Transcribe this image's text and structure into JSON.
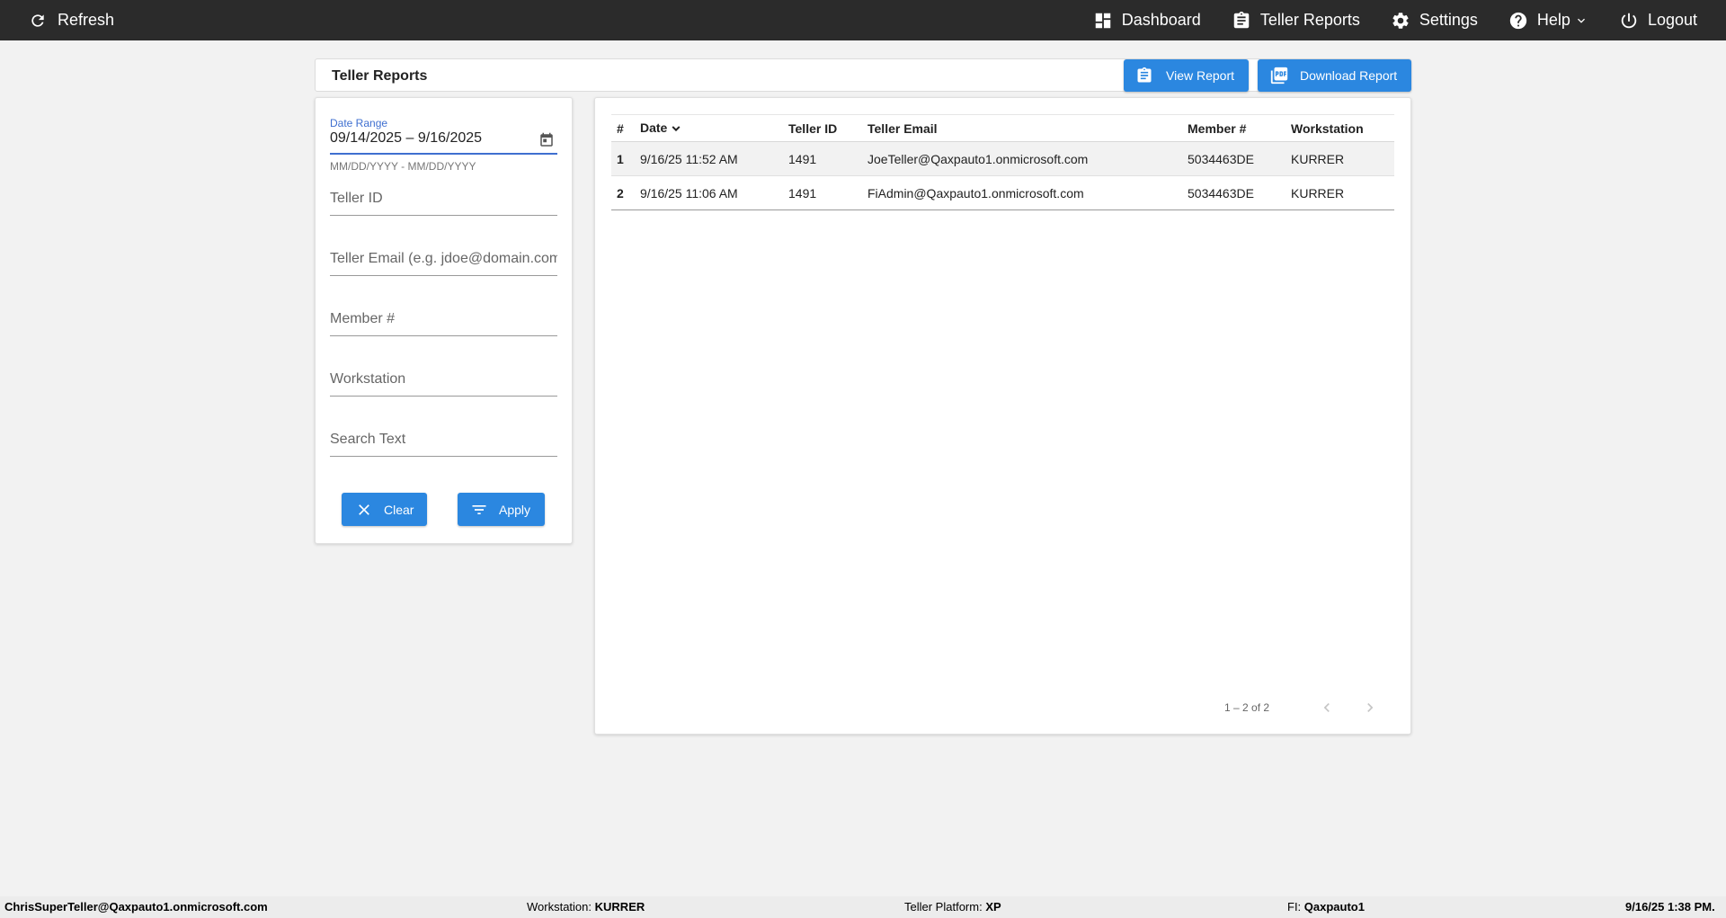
{
  "topbar": {
    "refresh_label": "Refresh",
    "nav": {
      "dashboard": "Dashboard",
      "teller_reports": "Teller Reports",
      "settings": "Settings",
      "help": "Help",
      "logout": "Logout"
    }
  },
  "page": {
    "title": "Teller Reports",
    "view_report_label": "View Report",
    "download_report_label": "Download Report"
  },
  "filters": {
    "date_range_label": "Date Range",
    "date_start": "09/14/2025",
    "date_separator": "–",
    "date_end": "9/16/2025",
    "date_hint": "MM/DD/YYYY - MM/DD/YYYY",
    "teller_id_placeholder": "Teller ID",
    "teller_email_placeholder": "Teller Email (e.g. jdoe@domain.com)",
    "member_placeholder": "Member #",
    "workstation_placeholder": "Workstation",
    "search_placeholder": "Search Text",
    "clear_label": "Clear",
    "apply_label": "Apply"
  },
  "table": {
    "headers": {
      "num": "#",
      "date": "Date",
      "teller_id": "Teller ID",
      "teller_email": "Teller Email",
      "member": "Member #",
      "workstation": "Workstation"
    },
    "rows": [
      {
        "num": "1",
        "date": "9/16/25 11:52 AM",
        "teller_id": "1491",
        "teller_email": "JoeTeller@Qaxpauto1.onmicrosoft.com",
        "member": "5034463DE",
        "workstation": "KURRER"
      },
      {
        "num": "2",
        "date": "9/16/25 11:06 AM",
        "teller_id": "1491",
        "teller_email": "FiAdmin@Qaxpauto1.onmicrosoft.com",
        "member": "5034463DE",
        "workstation": "KURRER"
      }
    ],
    "pager_text": "1 – 2 of 2"
  },
  "footer": {
    "user": "ChrisSuperTeller@Qaxpauto1.onmicrosoft.com",
    "workstation_label": "Workstation:",
    "workstation_value": "KURRER",
    "platform_label": "Teller Platform:",
    "platform_value": "XP",
    "fi_label": "FI:",
    "fi_value": "Qaxpauto1",
    "timestamp": "9/16/25 1:38 PM."
  },
  "colors": {
    "topbar_bg": "#2b2b2b",
    "accent_blue": "#2b87e0",
    "focus_blue": "#3f6fd0",
    "page_bg": "#f2f2f2"
  }
}
